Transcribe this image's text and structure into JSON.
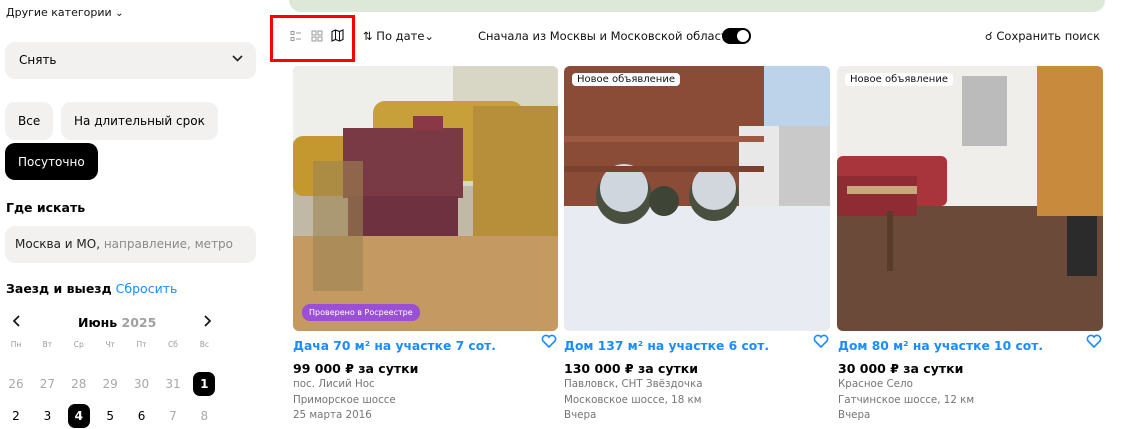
{
  "sidebar": {
    "other_categories": "Другие категории",
    "deal_select": "Снять",
    "term_pills": [
      "Все",
      "На длительный срок",
      "Посуточно"
    ],
    "where_title": "Где искать",
    "location_typed": "Москва и МО,",
    "location_placeholder": " направление, метро",
    "dates_title": "Заезд и выезд",
    "reset_label": "Сбросить",
    "calendar": {
      "month": "Июнь",
      "year": "2025",
      "weekdays": [
        "Пн",
        "Вт",
        "Ср",
        "Чт",
        "Пт",
        "Сб",
        "Вс"
      ],
      "row1": [
        "26",
        "27",
        "28",
        "29",
        "30",
        "31",
        "1"
      ],
      "row2": [
        "2",
        "3",
        "4",
        "5",
        "6",
        "7",
        "8"
      ]
    }
  },
  "toolbar": {
    "sort_label": "По дате",
    "moscow_first_label": "Сначала из Москвы и Московской области",
    "save_search_label": "Сохранить поиск"
  },
  "listings": [
    {
      "title": "Дача 70 м² на участке 7 сот.",
      "price": "99 000 ₽ за сутки",
      "line1": "пос. Лисий Нос",
      "line2": "Приморское шоссе",
      "line3": "25 марта 2016",
      "badge": "",
      "verified": "Проверено в Росреестре"
    },
    {
      "title": "Дом 137 м² на участке 6 сот.",
      "price": "130 000 ₽ за сутки",
      "line1": "Павловск, СНТ Звёздочка",
      "line2": "Московское шоссе, 18 км",
      "line3": "Вчера",
      "badge": "Новое объявление",
      "verified": ""
    },
    {
      "title": "Дом 80 м² на участке 10 сот.",
      "price": "30 000 ₽ за сутки",
      "line1": "Красное Село",
      "line2": "Гатчинское шоссе, 12 км",
      "line3": "Вчера",
      "badge": "Новое объявление",
      "verified": ""
    }
  ],
  "icons": {
    "heart": "♡",
    "chevron": "⌄",
    "arrow_left": "‹",
    "arrow_right": "›"
  },
  "colors": {
    "accent": "#1a8cff",
    "highlight_box": "#ff0000",
    "verified_badge": "#9b4fd4"
  }
}
